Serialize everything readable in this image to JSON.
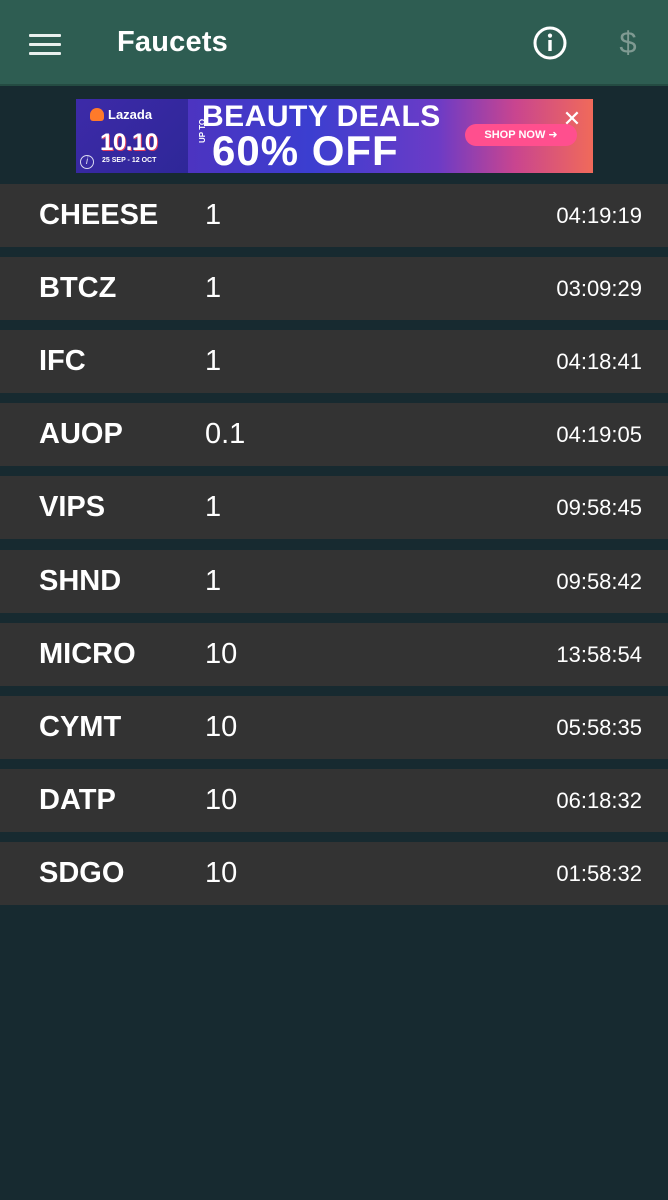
{
  "appbar": {
    "title": "Faucets",
    "menu_icon": "hamburger-menu-icon",
    "info_icon": "info-icon",
    "dollar_icon": "dollar-icon",
    "dollar_glyph": "$",
    "background": "#2e5d52"
  },
  "ad": {
    "brand": "Lazada",
    "date_big": "10.10",
    "date_range": "25 SEP - 12 OCT",
    "headline": "BEAUTY DEALS",
    "up_to": "UP TO",
    "discount": "60% OFF",
    "cta": "SHOP NOW ➜",
    "close_glyph": "✕",
    "info_glyph": "i"
  },
  "faucets": [
    {
      "symbol": "CHEESE",
      "amount": "1",
      "time": "04:19:19"
    },
    {
      "symbol": "BTCZ",
      "amount": "1",
      "time": "03:09:29"
    },
    {
      "symbol": "IFC",
      "amount": "1",
      "time": "04:18:41"
    },
    {
      "symbol": "AUOP",
      "amount": "0.1",
      "time": "04:19:05"
    },
    {
      "symbol": "VIPS",
      "amount": "1",
      "time": "09:58:45"
    },
    {
      "symbol": "SHND",
      "amount": "1",
      "time": "09:58:42"
    },
    {
      "symbol": "MICRO",
      "amount": "10",
      "time": "13:58:54"
    },
    {
      "symbol": "CYMT",
      "amount": "10",
      "time": "05:58:35"
    },
    {
      "symbol": "DATP",
      "amount": "10",
      "time": "06:18:32"
    },
    {
      "symbol": "SDGO",
      "amount": "10",
      "time": "01:58:32"
    }
  ],
  "colors": {
    "background": "#172a30",
    "row": "#333333",
    "text": "#ffffff"
  }
}
